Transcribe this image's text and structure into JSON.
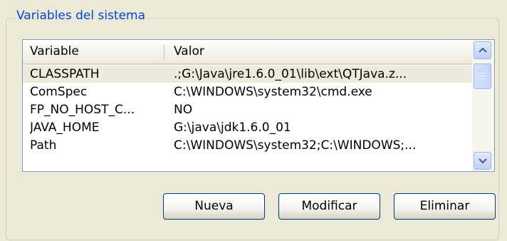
{
  "group": {
    "title": "Variables del sistema"
  },
  "list": {
    "columns": [
      "Variable",
      "Valor"
    ],
    "rows": [
      {
        "variable": "CLASSPATH",
        "value": ".;G:\\Java\\jre1.6.0_01\\lib\\ext\\QTJava.z...",
        "selected": true
      },
      {
        "variable": "ComSpec",
        "value": "C:\\WINDOWS\\system32\\cmd.exe",
        "selected": false
      },
      {
        "variable": "FP_NO_HOST_C...",
        "value": "NO",
        "selected": false
      },
      {
        "variable": "JAVA_HOME",
        "value": "G:\\java\\jdk1.6.0_01",
        "selected": false
      },
      {
        "variable": "Path",
        "value": "C:\\WINDOWS\\system32;C:\\WINDOWS;...",
        "selected": false
      }
    ]
  },
  "scrollbar": {
    "up_icon": "chevron-up-icon",
    "down_icon": "chevron-down-icon"
  },
  "buttons": {
    "new_label": "Nueva",
    "edit_label": "Modificar",
    "delete_label": "Eliminar"
  },
  "colors": {
    "title": "#0046d5",
    "dialog_bg": "#ece9d8",
    "list_border": "#7f9db9",
    "button_border": "#003c74"
  }
}
